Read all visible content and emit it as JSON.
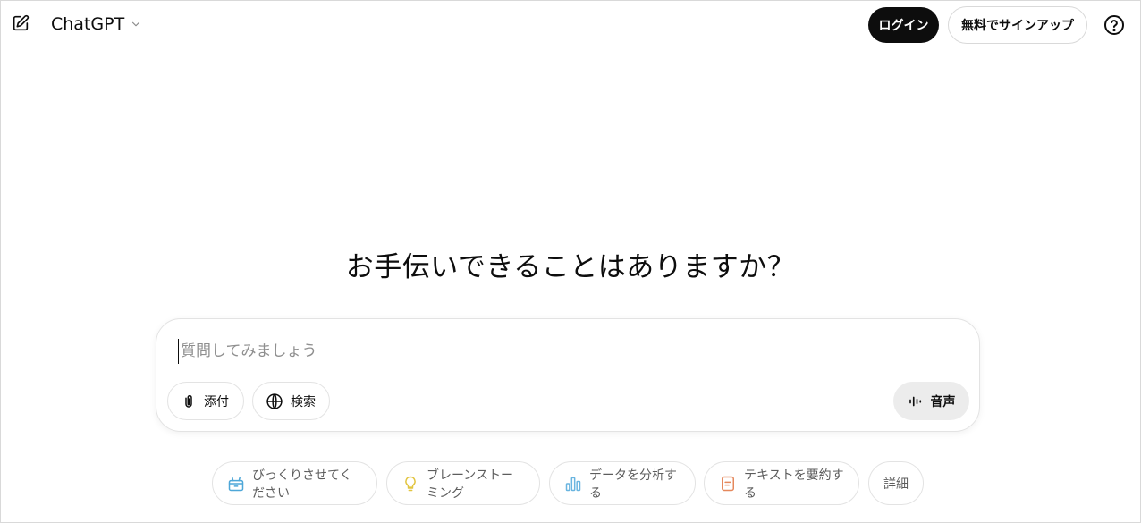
{
  "header": {
    "model_name": "ChatGPT",
    "login_label": "ログイン",
    "signup_label": "無料でサインアップ"
  },
  "main": {
    "headline": "お手伝いできることはありますか？"
  },
  "composer": {
    "placeholder": "質問してみましょう",
    "value": "",
    "attach_label": "添付",
    "search_label": "検索",
    "voice_label": "音声"
  },
  "suggestions": [
    {
      "label": "びっくりさせてください",
      "icon": "gift-icon",
      "color": "#4ea7d8"
    },
    {
      "label": "ブレーンストーミング",
      "icon": "lightbulb-icon",
      "color": "#e2c541"
    },
    {
      "label": "データを分析する",
      "icon": "bar-chart-icon",
      "color": "#6ab5e0"
    },
    {
      "label": "テキストを要約する",
      "icon": "document-icon",
      "color": "#e5885c"
    },
    {
      "label": "詳細",
      "icon": "",
      "color": ""
    }
  ],
  "colors": {
    "login_bg": "#0d0d0d",
    "voice_bg": "#ececec",
    "text": "#0d0d0d",
    "muted": "#5d5d5d"
  }
}
